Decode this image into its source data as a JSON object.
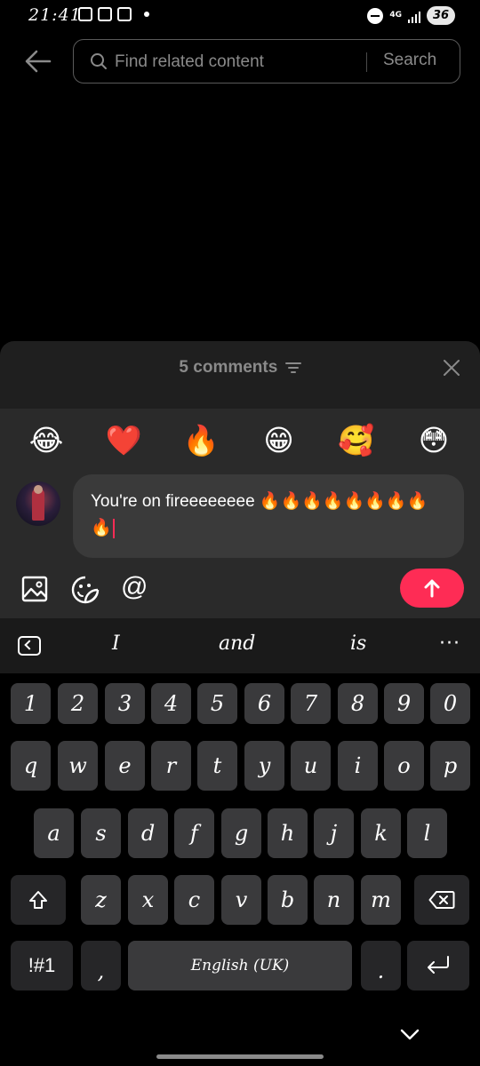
{
  "status_bar": {
    "time": "21:41",
    "network": "4G",
    "battery": "36"
  },
  "search": {
    "placeholder": "Find related content",
    "button_label": "Search"
  },
  "comments": {
    "title": "5 comments"
  },
  "emoji_bar": [
    "😂",
    "❤️",
    "🔥",
    "😁",
    "🥰",
    "😳"
  ],
  "comment_input": {
    "value": "You're on fireeeeeeee 🔥🔥🔥🔥🔥🔥🔥🔥🔥"
  },
  "toolbar": {
    "mention": "@"
  },
  "keyboard": {
    "suggestions": [
      "I",
      "and",
      "is"
    ],
    "more": "···",
    "numbers": [
      "1",
      "2",
      "3",
      "4",
      "5",
      "6",
      "7",
      "8",
      "9",
      "0"
    ],
    "row1": [
      "q",
      "w",
      "e",
      "r",
      "t",
      "y",
      "u",
      "i",
      "o",
      "p"
    ],
    "row2": [
      "a",
      "s",
      "d",
      "f",
      "g",
      "h",
      "j",
      "k",
      "l"
    ],
    "row3": [
      "z",
      "x",
      "c",
      "v",
      "b",
      "n",
      "m"
    ],
    "symbols_label": "!#1",
    "comma": ",",
    "space_label": "English (UK)",
    "period": "."
  },
  "colors": {
    "accent": "#fe2c55",
    "sheet_bg": "#1f1f1f",
    "key_bg": "#3a3a3c"
  }
}
